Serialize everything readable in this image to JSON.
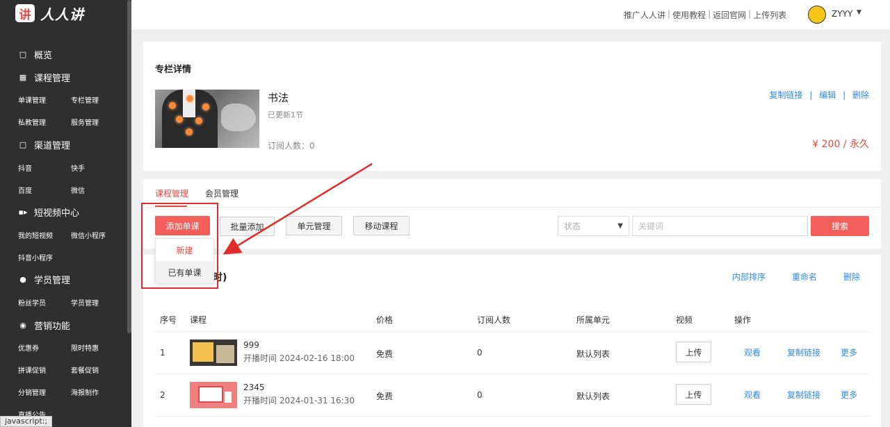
{
  "app": {
    "logo_mark": "讲",
    "logo_text": "人人讲"
  },
  "sidebar": {
    "sections": [
      {
        "label": "概览",
        "icon": "square-icon"
      },
      {
        "label": "课程管理",
        "icon": "grid-icon",
        "items": [
          "单课管理",
          "专栏管理",
          "私教管理",
          "服务管理"
        ]
      },
      {
        "label": "渠道管理",
        "icon": "square-icon",
        "items": [
          "抖音",
          "快手",
          "百度",
          "微信"
        ]
      },
      {
        "label": "短视频中心",
        "icon": "video-icon",
        "items": [
          "我的短视频",
          "微信小程序",
          "抖音小程序"
        ]
      },
      {
        "label": "学员管理",
        "icon": "user-icon",
        "items": [
          "粉丝学员",
          "学员管理"
        ]
      },
      {
        "label": "营销功能",
        "icon": "bag-icon",
        "items": [
          "优惠券",
          "限时特惠",
          "拼课促销",
          "套餐促销",
          "分销管理",
          "海报制作",
          "直播公告"
        ]
      }
    ]
  },
  "topbar": {
    "links": [
      "推广人人讲",
      "使用教程",
      "返回官网",
      "上传列表"
    ],
    "separator": "|",
    "username": "ZYYY"
  },
  "column": {
    "section_title": "专栏详情",
    "name": "书法",
    "updated": "已更新1节",
    "subscribers": "订阅人数：0",
    "actions": [
      "复制链接",
      "编辑",
      "删除"
    ],
    "action_sep": "|",
    "price": "¥ 200 / 永久"
  },
  "tabs": [
    "课程管理",
    "会员管理"
  ],
  "toolbar": {
    "add_single": "添加单课",
    "batch_add": "批量添加",
    "unit_manage": "单元管理",
    "move_course": "移动课程",
    "status_placeholder": "状态",
    "keyword_placeholder": "关键词",
    "search": "搜索"
  },
  "dropdown": {
    "new": "新建",
    "existing": "已有单课"
  },
  "unit": {
    "title_fragment": "时)",
    "links": [
      "内部排序",
      "重命名",
      "删除"
    ]
  },
  "table": {
    "headers": [
      "序号",
      "课程",
      "价格",
      "订阅人数",
      "所属单元",
      "视频",
      "操作"
    ],
    "rows": [
      {
        "index": "1",
        "title": "999",
        "time": "开播时间 2024-02-16 18:00",
        "price": "免费",
        "subs": "0",
        "unit": "默认列表",
        "video_btn": "上传",
        "ops": [
          "观看",
          "复制链接",
          "更多"
        ]
      },
      {
        "index": "2",
        "title": "2345",
        "time": "开播时间 2024-01-31 16:30",
        "price": "免费",
        "subs": "0",
        "unit": "默认列表",
        "video_btn": "上传",
        "ops": [
          "观看",
          "复制链接",
          "更多"
        ]
      }
    ]
  },
  "status_bar": "javascript:;",
  "colors": {
    "accent_red": "#f35e5b",
    "link_blue": "#2f8ae6",
    "annotation_red": "#e02b2b",
    "sidebar_bg": "#2f2f2f"
  }
}
